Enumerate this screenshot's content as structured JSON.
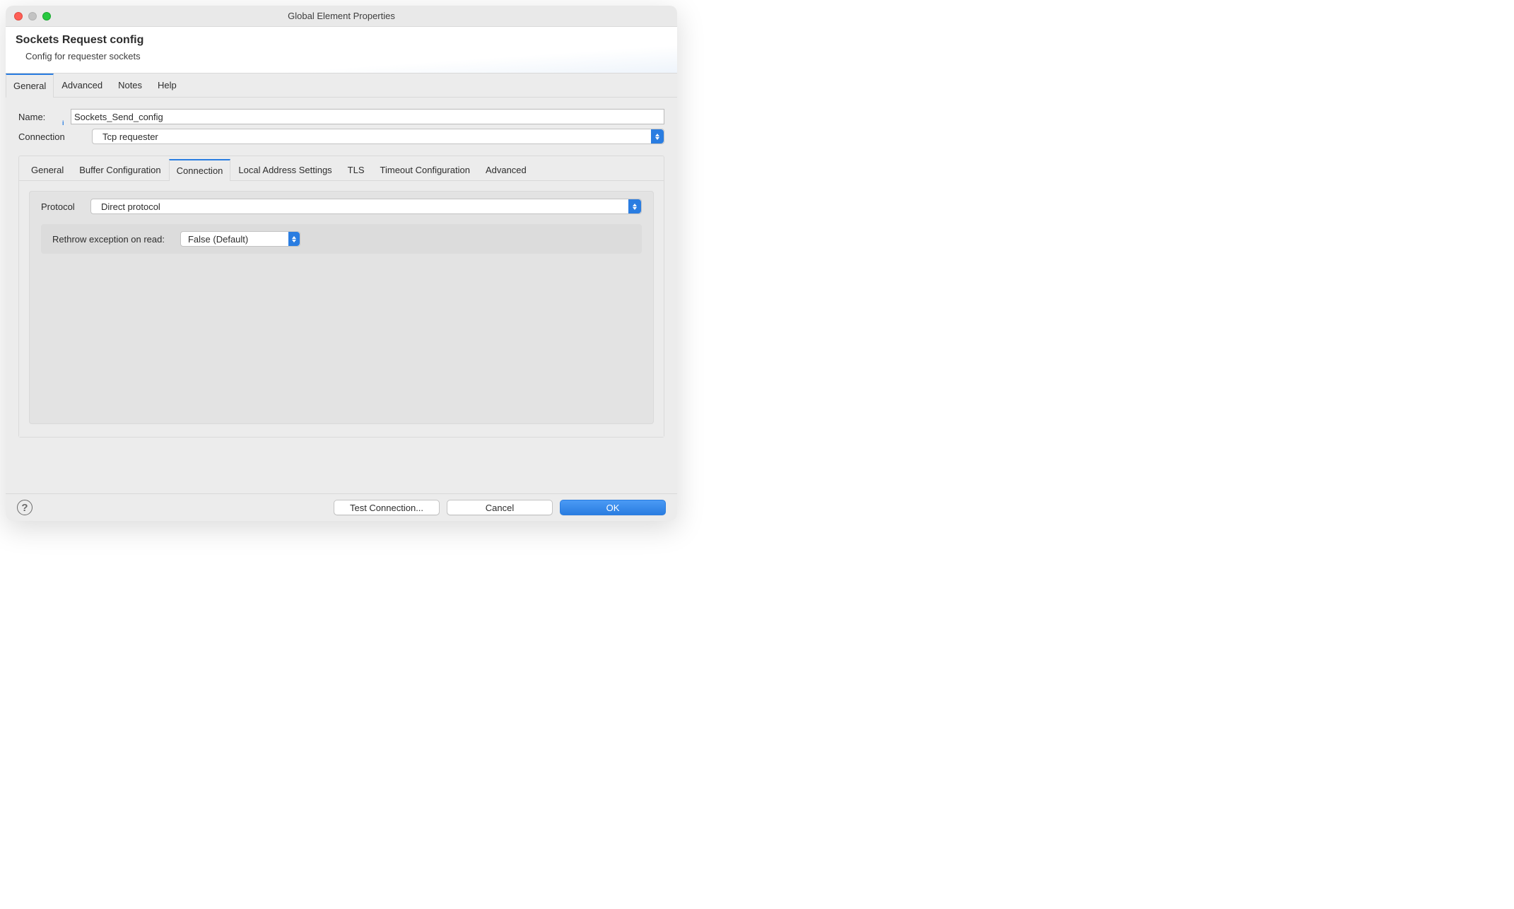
{
  "window": {
    "title": "Global Element Properties"
  },
  "header": {
    "title": "Sockets Request config",
    "subtitle": "Config for requester sockets"
  },
  "outerTabs": {
    "t0": "General",
    "t1": "Advanced",
    "t2": "Notes",
    "t3": "Help",
    "activeIndex": 0
  },
  "fields": {
    "nameLabel": "Name:",
    "nameValue": "Sockets_Send_config",
    "connectionLabel": "Connection",
    "connectionValue": "Tcp requester"
  },
  "innerTabs": {
    "t0": "General",
    "t1": "Buffer Configuration",
    "t2": "Connection",
    "t3": "Local Address Settings",
    "t4": "TLS",
    "t5": "Timeout Configuration",
    "t6": "Advanced",
    "activeIndex": 2
  },
  "protocol": {
    "label": "Protocol",
    "value": "Direct protocol"
  },
  "rethrow": {
    "label": "Rethrow exception on read:",
    "value": "False (Default)"
  },
  "footer": {
    "testConnection": "Test Connection...",
    "cancel": "Cancel",
    "ok": "OK"
  }
}
